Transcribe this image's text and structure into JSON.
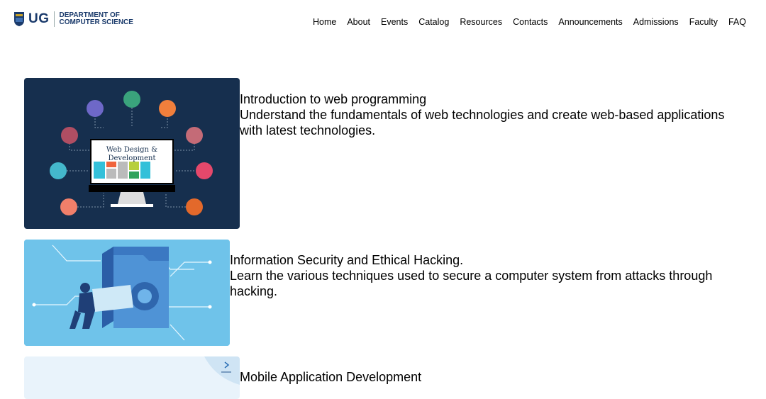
{
  "brand": {
    "ug": "UG",
    "dept_line1": "DEPARTMENT OF",
    "dept_line2": "COMPUTER SCIENCE"
  },
  "nav": [
    "Home",
    "About",
    "Events",
    "Catalog",
    "Resources",
    "Contacts",
    "Announcements",
    "Admissions",
    "Faculty",
    "FAQ"
  ],
  "courses": [
    {
      "title": "Introduction to web programming",
      "description": "Understand the fundamentals of web technologies and create web-based applications with latest technologies.",
      "image_text_1": "Web Design &",
      "image_text_2": "Development"
    },
    {
      "title": "Information Security and Ethical Hacking.",
      "description": "Learn the various techniques used to secure a computer system from attacks through hacking."
    },
    {
      "title": "Mobile Application Development"
    }
  ],
  "colors": {
    "web_bg": "#162f4e",
    "security_bg": "#6fc3ea",
    "brand": "#1a3a6b"
  }
}
